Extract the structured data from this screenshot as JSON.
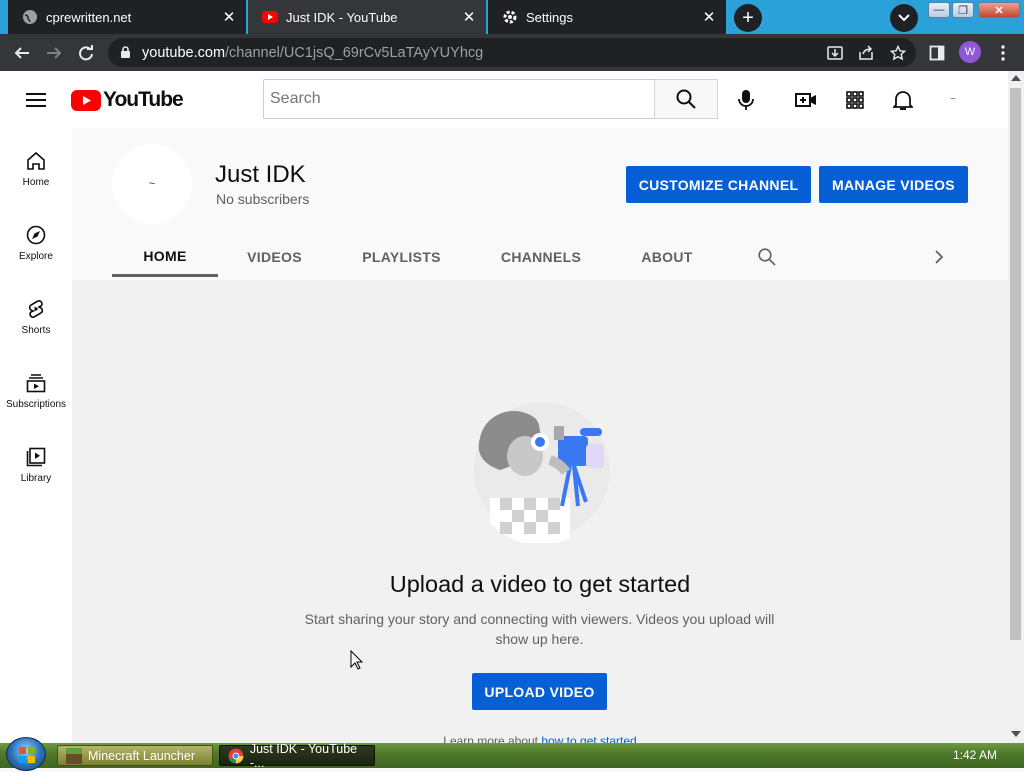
{
  "browser": {
    "tabs": [
      {
        "label": "cprewritten.net"
      },
      {
        "label": "Just IDK - YouTube"
      },
      {
        "label": "Settings"
      }
    ],
    "close_glyph": "✕",
    "new_tab_glyph": "+",
    "window_controls": {
      "minimize": "—",
      "maximize": "❐",
      "close": "✕"
    },
    "url_host": "youtube.com",
    "url_path": "/channel/UC1jsQ_69rCv5LaTAyYUYhcg",
    "profile_initial": "W"
  },
  "youtube": {
    "logo_text": "YouTube",
    "search_placeholder": "Search",
    "guide": [
      {
        "label": "Home"
      },
      {
        "label": "Explore"
      },
      {
        "label": "Shorts"
      },
      {
        "label": "Subscriptions"
      },
      {
        "label": "Library"
      }
    ],
    "masthead_avatar_text": "~",
    "channel": {
      "avatar_text": "~",
      "name": "Just IDK",
      "subscribers": "No subscribers",
      "customize_button": "CUSTOMIZE CHANNEL",
      "manage_button": "MANAGE VIDEOS",
      "tabs": [
        {
          "label": "HOME"
        },
        {
          "label": "VIDEOS"
        },
        {
          "label": "PLAYLISTS"
        },
        {
          "label": "CHANNELS"
        },
        {
          "label": "ABOUT"
        }
      ],
      "active_tab": "HOME"
    },
    "empty_state": {
      "title": "Upload a video to get started",
      "description": "Start sharing your story and connecting with viewers. Videos you upload will show up here.",
      "upload_button": "UPLOAD VIDEO",
      "learn_prefix": "Learn more about ",
      "learn_link": "how to get started"
    },
    "colors": {
      "brand_red": "#ff0000",
      "accent_blue": "#065fd4"
    }
  },
  "taskbar": {
    "items": [
      {
        "label": "Minecraft Launcher"
      },
      {
        "label": "Just IDK - YouTube -..."
      }
    ],
    "clock": "1:42 AM"
  }
}
